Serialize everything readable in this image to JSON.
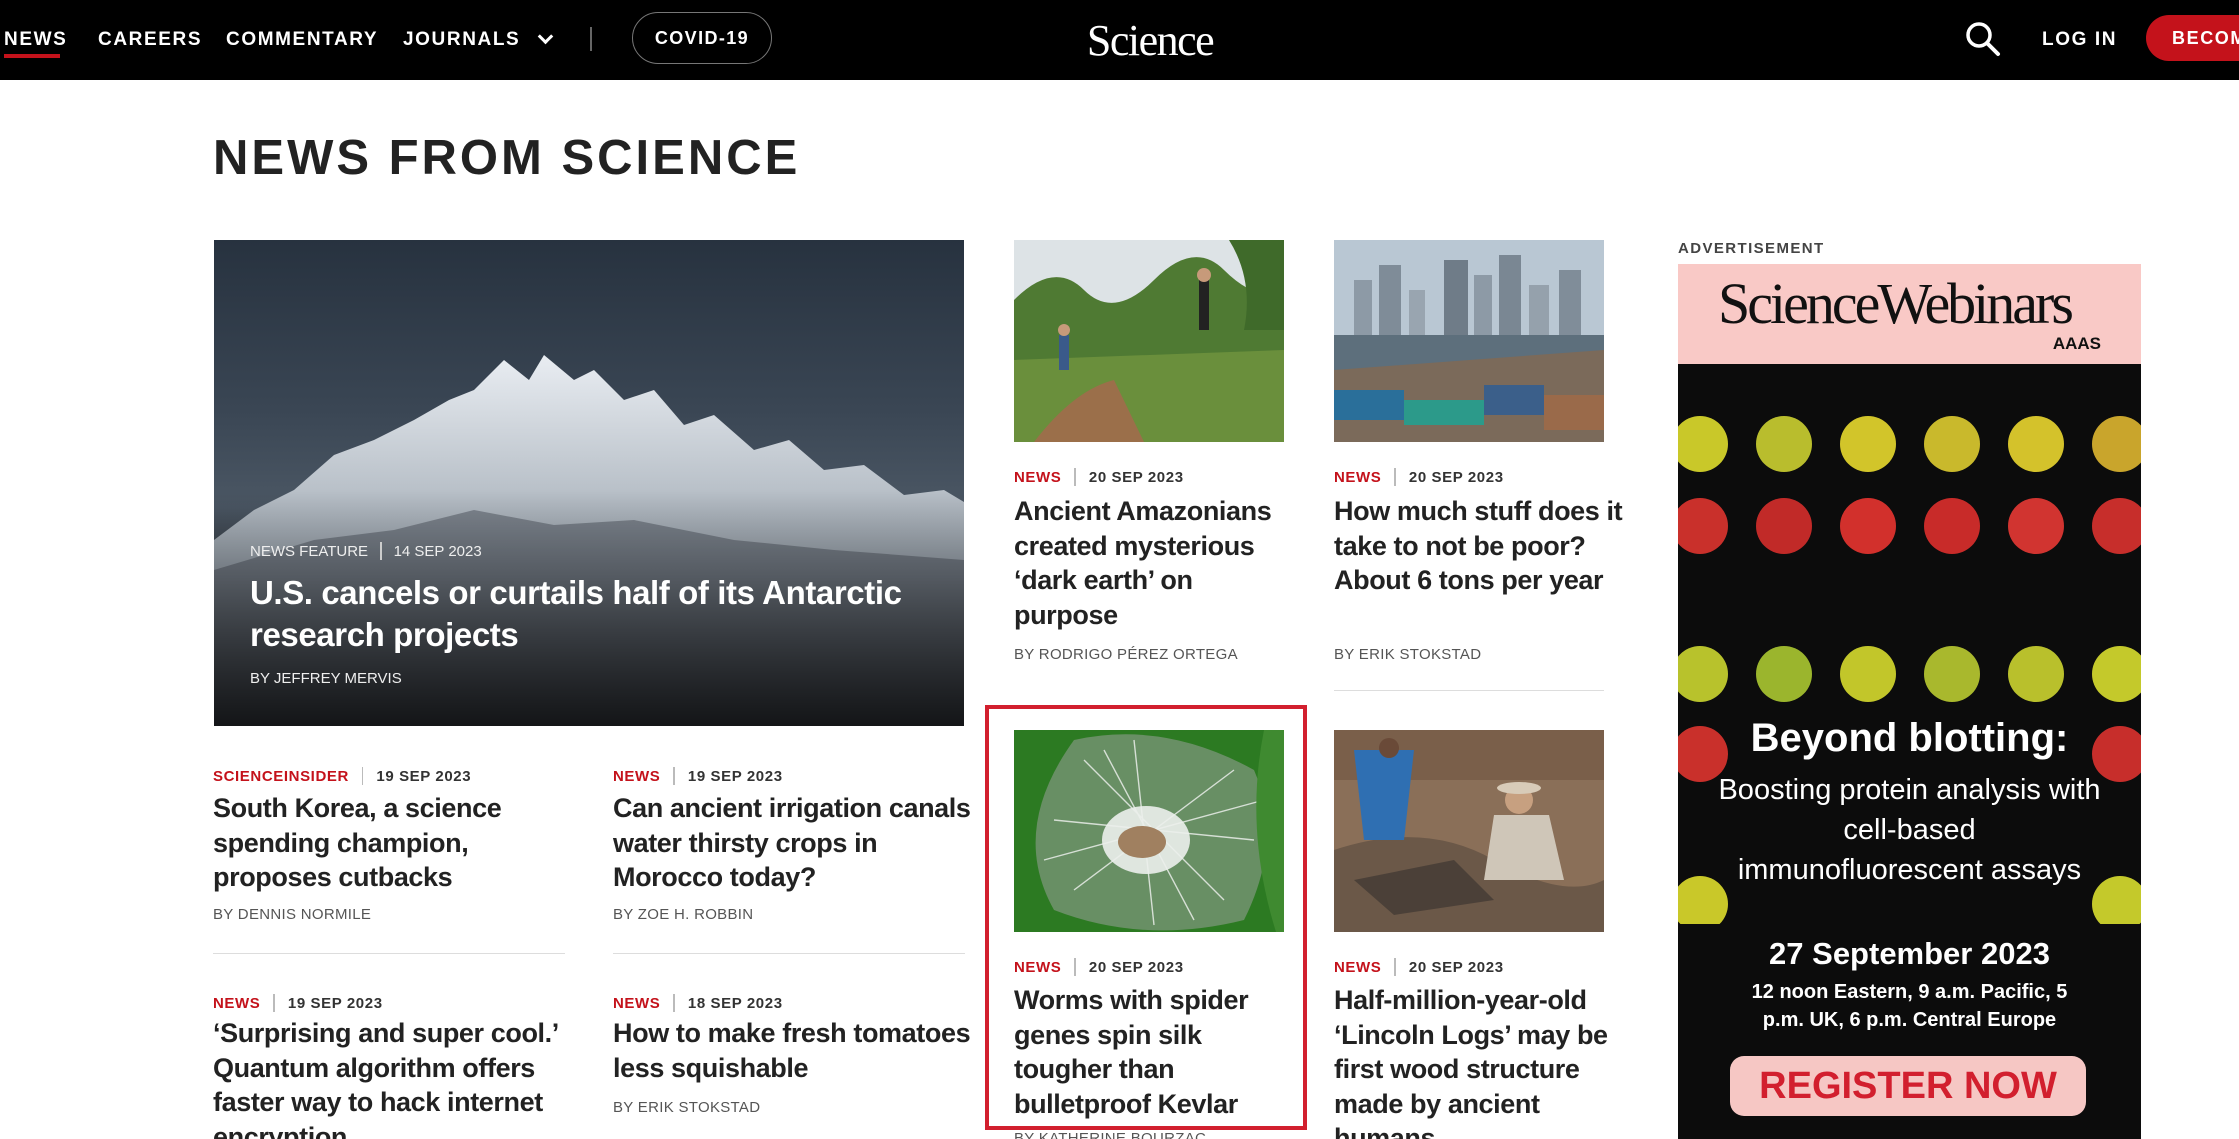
{
  "nav": {
    "items": [
      "NEWS",
      "CAREERS",
      "COMMENTARY",
      "JOURNALS"
    ],
    "covid_label": "COVID-19",
    "logo": "Science",
    "login_label": "LOG IN",
    "become_label": "BECOM",
    "accent_color": "#c4121b"
  },
  "page_title": "NEWS FROM SCIENCE",
  "feature": {
    "kind": "NEWS FEATURE",
    "date": "14 SEP 2023",
    "title": "U.S. cancels or curtails half of its Antarctic research projects",
    "byline": "BY JEFFREY MERVIS"
  },
  "cards": [
    {
      "kind": "NEWS",
      "date": "20 SEP 2023",
      "title": "Ancient Amazonians created mysterious ‘dark earth’ on purpose",
      "byline": "BY RODRIGO PÉREZ ORTEGA"
    },
    {
      "kind": "NEWS",
      "date": "20 SEP 2023",
      "title": "How much stuff does it take to not be poor? About 6 tons per year",
      "byline": "BY ERIK STOKSTAD"
    },
    {
      "kind": "SCIENCEINSIDER",
      "date": "19 SEP 2023",
      "title": "South Korea, a science spending champion, proposes cutbacks",
      "byline": "BY DENNIS NORMILE"
    },
    {
      "kind": "NEWS",
      "date": "19 SEP 2023",
      "title": "Can ancient irrigation canals water thirsty crops in Morocco today?",
      "byline": "BY ZOE H. ROBBIN"
    },
    {
      "kind": "NEWS",
      "date": "20 SEP 2023",
      "title": "Worms with spider genes spin silk tougher than bulletproof Kevlar",
      "byline": "BY KATHERINE BOURZAC"
    },
    {
      "kind": "NEWS",
      "date": "20 SEP 2023",
      "title": "Half-million-year-old ‘Lincoln Logs’ may be first wood structure made by ancient humans"
    },
    {
      "kind": "NEWS",
      "date": "19 SEP 2023",
      "title": "‘Surprising and super cool.’ Quantum algorithm offers faster way to hack internet encryption"
    },
    {
      "kind": "NEWS",
      "date": "18 SEP 2023",
      "title": "How to make fresh tomatoes less squishable",
      "byline": "BY ERIK STOKSTAD"
    }
  ],
  "ad": {
    "label": "ADVERTISEMENT",
    "brand": "ScienceWebinars",
    "org": "AAAS",
    "headline": "Beyond blotting:",
    "body": "Boosting protein analysis with cell-based immunofluorescent assays",
    "date": "27 September 2023",
    "times": "12 noon Eastern, 9 a.m. Pacific, 5 p.m. UK, 6 p.m. Central Europe",
    "cta": "REGISTER NOW"
  }
}
